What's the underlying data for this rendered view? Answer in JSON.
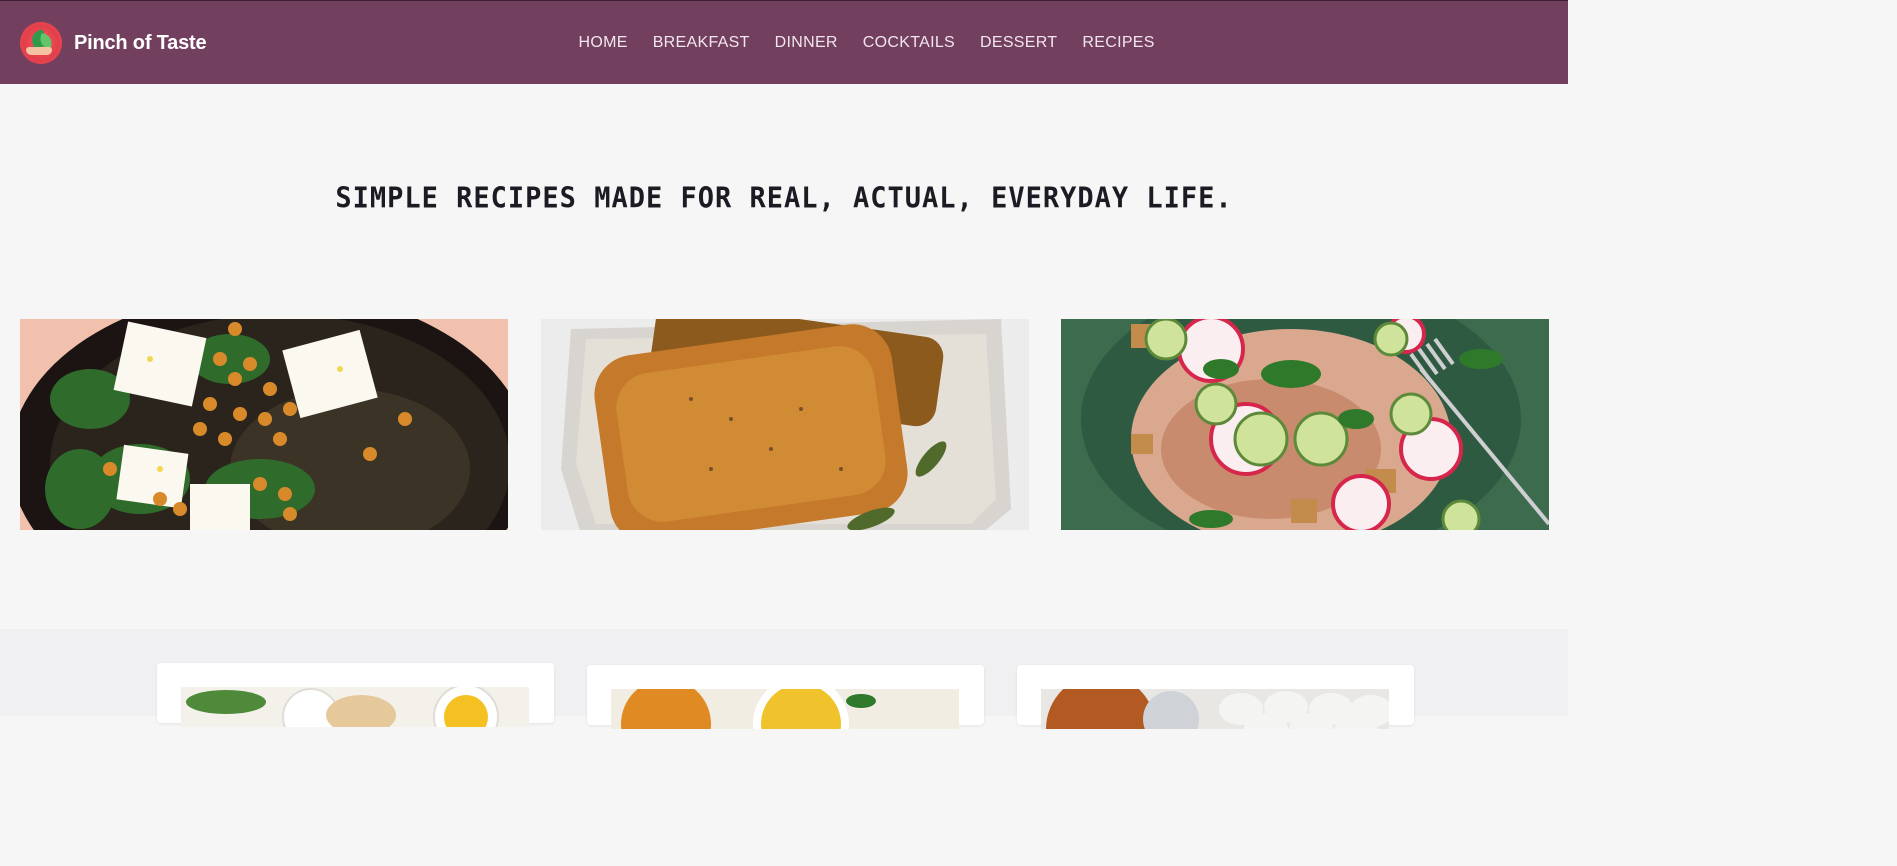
{
  "header": {
    "brand": "Pinch of Taste",
    "logo_icon": "leaf-hand-logo",
    "nav": [
      "HOME",
      "BREAKFAST",
      "DINNER",
      "COCKTAILS",
      "DESSERT",
      "RECIPES"
    ]
  },
  "hero": {
    "tagline": "SIMPLE RECIPES MADE FOR REAL, ACTUAL, EVERYDAY LIFE."
  },
  "colors": {
    "header_bg": "#733f5f",
    "page_bg": "#f6f6f6",
    "section_bg": "#f0f0f2",
    "text_dark": "#1b1b24"
  }
}
